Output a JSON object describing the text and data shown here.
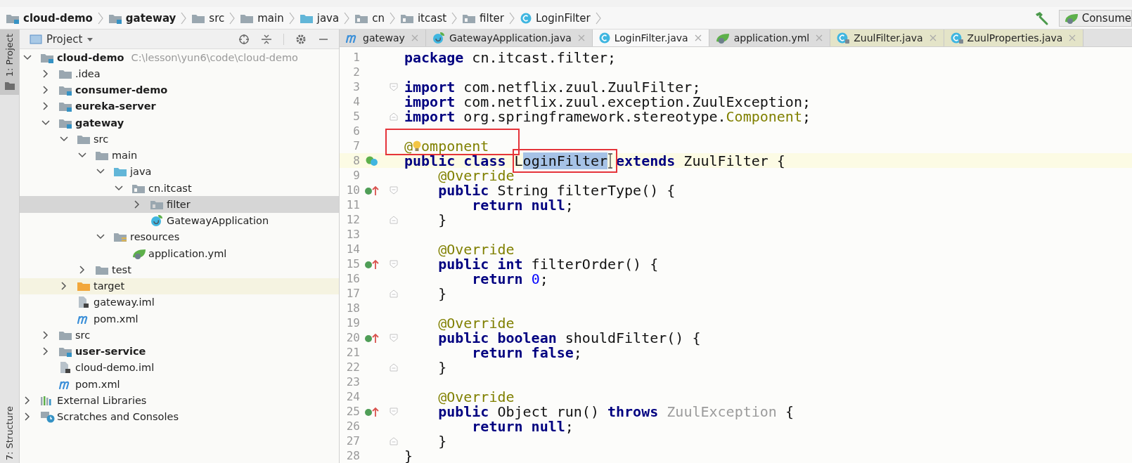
{
  "breadcrumbs": [
    {
      "label": "cloud-demo",
      "kind": "module"
    },
    {
      "label": "gateway",
      "kind": "module"
    },
    {
      "label": "src",
      "kind": "folder"
    },
    {
      "label": "main",
      "kind": "folder"
    },
    {
      "label": "java",
      "kind": "source"
    },
    {
      "label": "cn",
      "kind": "package"
    },
    {
      "label": "itcast",
      "kind": "package"
    },
    {
      "label": "filter",
      "kind": "package"
    },
    {
      "label": "LoginFilter",
      "kind": "class"
    }
  ],
  "run_config": {
    "label": "Consume"
  },
  "tool_strip": {
    "top": [
      {
        "label": "1: Project",
        "selected": true
      }
    ],
    "bottom": [
      {
        "label": "7: Structure",
        "selected": false
      }
    ]
  },
  "project_panel": {
    "title": "Project",
    "tree": [
      {
        "label": "cloud-demo",
        "kind": "module",
        "hint": "C:\\lesson\\yun6\\code\\cloud-demo",
        "expanded": true,
        "selected": false,
        "children": [
          {
            "label": ".idea",
            "kind": "folder",
            "expanded": false,
            "selected": false
          },
          {
            "label": "consumer-demo",
            "kind": "module",
            "expanded": false,
            "selected": false
          },
          {
            "label": "eureka-server",
            "kind": "module",
            "expanded": false,
            "selected": false
          },
          {
            "label": "gateway",
            "kind": "module",
            "expanded": true,
            "selected": false,
            "children": [
              {
                "label": "src",
                "kind": "folder",
                "expanded": true,
                "selected": false,
                "children": [
                  {
                    "label": "main",
                    "kind": "folder",
                    "expanded": true,
                    "selected": false,
                    "children": [
                      {
                        "label": "java",
                        "kind": "source",
                        "expanded": true,
                        "selected": false,
                        "children": [
                          {
                            "label": "cn.itcast",
                            "kind": "package",
                            "expanded": true,
                            "selected": false,
                            "children": [
                              {
                                "label": "filter",
                                "kind": "package",
                                "expanded": false,
                                "selected": true
                              },
                              {
                                "label": "GatewayApplication",
                                "kind": "spring-class",
                                "selected": false
                              }
                            ]
                          }
                        ]
                      },
                      {
                        "label": "resources",
                        "kind": "resources",
                        "expanded": true,
                        "selected": false,
                        "children": [
                          {
                            "label": "application.yml",
                            "kind": "yml",
                            "selected": false
                          }
                        ]
                      }
                    ]
                  },
                  {
                    "label": "test",
                    "kind": "folder",
                    "expanded": false,
                    "selected": false
                  }
                ]
              },
              {
                "label": "target",
                "kind": "excluded",
                "expanded": false,
                "selected": false
              },
              {
                "label": "gateway.iml",
                "kind": "iml",
                "selected": false
              },
              {
                "label": "pom.xml",
                "kind": "maven",
                "selected": false
              }
            ]
          },
          {
            "label": "src",
            "kind": "folder",
            "expanded": false,
            "selected": false
          },
          {
            "label": "user-service",
            "kind": "module",
            "expanded": false,
            "selected": false
          },
          {
            "label": "cloud-demo.iml",
            "kind": "iml",
            "selected": false
          },
          {
            "label": "pom.xml",
            "kind": "maven",
            "selected": false
          }
        ]
      },
      {
        "label": "External Libraries",
        "kind": "libraries",
        "expanded": false,
        "selected": false
      },
      {
        "label": "Scratches and Consoles",
        "kind": "scratches",
        "expanded": false,
        "selected": false
      }
    ]
  },
  "tabs": [
    {
      "label": "gateway",
      "kind": "maven",
      "selected": false
    },
    {
      "label": "GatewayApplication.java",
      "kind": "spring-class",
      "selected": false
    },
    {
      "label": "LoginFilter.java",
      "kind": "class",
      "selected": true
    },
    {
      "label": "application.yml",
      "kind": "yml",
      "selected": false
    },
    {
      "label": "ZuulFilter.java",
      "kind": "library-class",
      "selected": false
    },
    {
      "label": "ZuulProperties.java",
      "kind": "library-class",
      "selected": false
    }
  ],
  "code": [
    {
      "number": "1",
      "tokens": [
        {
          "kind": "kw",
          "text": "package"
        },
        {
          "kind": "plain",
          "text": " cn.itcast.filter;"
        }
      ]
    },
    {
      "number": "2"
    },
    {
      "number": "3",
      "fold_start": true,
      "tokens": [
        {
          "kind": "kw",
          "text": "import"
        },
        {
          "kind": "plain",
          "text": " com.netflix.zuul.ZuulFilter;"
        }
      ]
    },
    {
      "number": "4",
      "tokens": [
        {
          "kind": "kw",
          "text": "import"
        },
        {
          "kind": "plain",
          "text": " com.netflix.zuul.exception.ZuulException;"
        }
      ]
    },
    {
      "number": "5",
      "fold_end": true,
      "tokens": [
        {
          "kind": "kw",
          "text": "import"
        },
        {
          "kind": "plain",
          "text": " org.springframework.stereotype."
        },
        {
          "kind": "annotation",
          "text": "Component"
        },
        {
          "kind": "plain",
          "text": ";"
        }
      ]
    },
    {
      "number": "6"
    },
    {
      "number": "7",
      "tokens": [
        {
          "kind": "group",
          "boxed": true,
          "tokens": [
            {
              "kind": "annotation",
              "text": "@"
            },
            {
              "kind": "bulb"
            },
            {
              "kind": "annotation",
              "text": "omponent"
            }
          ]
        }
      ]
    },
    {
      "number": "8",
      "current": true,
      "class_marker": true,
      "tokens": [
        {
          "kind": "kw",
          "text": "public class "
        },
        {
          "kind": "group",
          "boxed": true,
          "tokens": [
            {
              "kind": "plain",
              "text": "L"
            },
            {
              "kind": "selected",
              "text": "oginFilter"
            },
            {
              "kind": "cursor"
            }
          ]
        },
        {
          "kind": "kw",
          "text": "extends"
        },
        {
          "kind": "plain",
          "text": " ZuulFilter {"
        }
      ]
    },
    {
      "number": "9",
      "tokens": [
        {
          "kind": "annotation",
          "text": "    @Override"
        }
      ]
    },
    {
      "number": "10",
      "override_marker": true,
      "fold_start": true,
      "tokens": [
        {
          "kind": "kw",
          "text": "    public"
        },
        {
          "kind": "plain",
          "text": " String filterType() {"
        }
      ]
    },
    {
      "number": "11",
      "tokens": [
        {
          "kind": "kw",
          "text": "        return null"
        },
        {
          "kind": "plain",
          "text": ";"
        }
      ]
    },
    {
      "number": "12",
      "fold_end": true,
      "tokens": [
        {
          "kind": "plain",
          "text": "    }"
        }
      ]
    },
    {
      "number": "13"
    },
    {
      "number": "14",
      "tokens": [
        {
          "kind": "annotation",
          "text": "    @Override"
        }
      ]
    },
    {
      "number": "15",
      "override_marker": true,
      "fold_start": true,
      "tokens": [
        {
          "kind": "kw",
          "text": "    public int"
        },
        {
          "kind": "plain",
          "text": " filterOrder() {"
        }
      ]
    },
    {
      "number": "16",
      "tokens": [
        {
          "kind": "kw",
          "text": "        return "
        },
        {
          "kind": "number",
          "text": "0"
        },
        {
          "kind": "plain",
          "text": ";"
        }
      ]
    },
    {
      "number": "17",
      "fold_end": true,
      "tokens": [
        {
          "kind": "plain",
          "text": "    }"
        }
      ]
    },
    {
      "number": "18"
    },
    {
      "number": "19",
      "tokens": [
        {
          "kind": "annotation",
          "text": "    @Override"
        }
      ]
    },
    {
      "number": "20",
      "override_marker": true,
      "fold_start": true,
      "tokens": [
        {
          "kind": "kw",
          "text": "    public boolean"
        },
        {
          "kind": "plain",
          "text": " shouldFilter() {"
        }
      ]
    },
    {
      "number": "21",
      "tokens": [
        {
          "kind": "kw",
          "text": "        return false"
        },
        {
          "kind": "plain",
          "text": ";"
        }
      ]
    },
    {
      "number": "22",
      "fold_end": true,
      "tokens": [
        {
          "kind": "plain",
          "text": "    }"
        }
      ]
    },
    {
      "number": "23"
    },
    {
      "number": "24",
      "tokens": [
        {
          "kind": "annotation",
          "text": "    @Override"
        }
      ]
    },
    {
      "number": "25",
      "override_marker": true,
      "fold_start": true,
      "tokens": [
        {
          "kind": "kw",
          "text": "    public"
        },
        {
          "kind": "plain",
          "text": " Object run() "
        },
        {
          "kind": "kw",
          "text": "throws "
        },
        {
          "kind": "unused",
          "text": "ZuulException"
        },
        {
          "kind": "plain",
          "text": " {"
        }
      ]
    },
    {
      "number": "26",
      "tokens": [
        {
          "kind": "kw",
          "text": "        return null"
        },
        {
          "kind": "plain",
          "text": ";"
        }
      ]
    },
    {
      "number": "27",
      "fold_end": true,
      "tokens": [
        {
          "kind": "plain",
          "text": "    }"
        }
      ]
    },
    {
      "number": "28",
      "tokens": [
        {
          "kind": "plain",
          "text": "}"
        }
      ]
    }
  ]
}
